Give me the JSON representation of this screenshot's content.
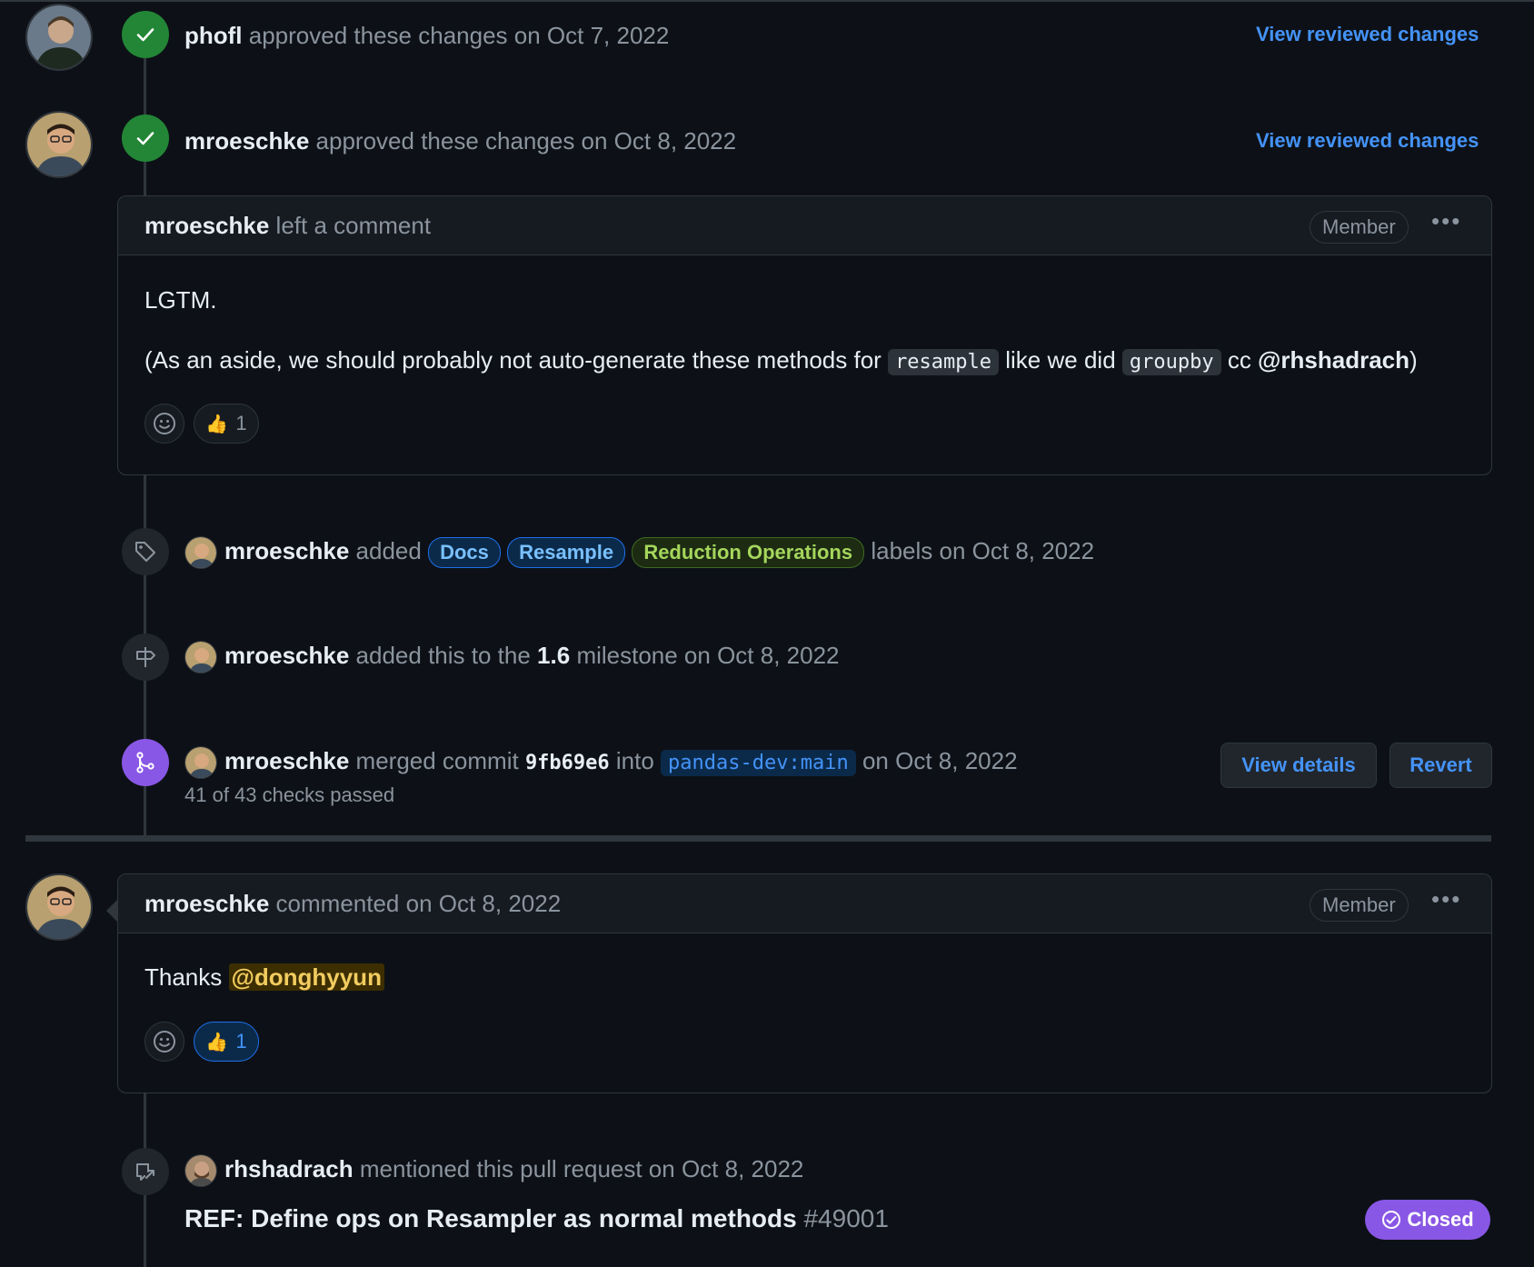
{
  "reviews": [
    {
      "user": "phofl",
      "action": "approved these changes on Oct 7, 2022",
      "link": "View reviewed changes"
    },
    {
      "user": "mroeschke",
      "action": "approved these changes on Oct 8, 2022",
      "link": "View reviewed changes"
    }
  ],
  "review_comment": {
    "user": "mroeschke",
    "action": "left a comment",
    "role": "Member",
    "line1": "LGTM.",
    "line2_part1": "(As an aside, we should probably not auto-generate these methods for ",
    "code1": "resample",
    "line2_part2": " like we did ",
    "code2": "groupby",
    "line2_part3": " cc ",
    "mention": "@rhshadrach",
    "line2_part4": ")",
    "reaction_emoji": "👍",
    "reaction_count": "1"
  },
  "labels_event": {
    "user": "mroeschke",
    "verb": "added",
    "labels": [
      {
        "name": "Docs",
        "bg": "#0b2a4a",
        "fg": "#79c0ff",
        "border": "#1f6feb"
      },
      {
        "name": "Resample",
        "bg": "#0b2a4a",
        "fg": "#79c0ff",
        "border": "#1f6feb"
      },
      {
        "name": "Reduction Operations",
        "bg": "#1c2b12",
        "fg": "#a5d65c",
        "border": "#3f6a1f"
      }
    ],
    "suffix": "labels on Oct 8, 2022"
  },
  "milestone_event": {
    "user": "mroeschke",
    "prefix": "added this to the",
    "milestone": "1.6",
    "suffix": "milestone on Oct 8, 2022"
  },
  "merge_event": {
    "user": "mroeschke",
    "prefix": "merged commit",
    "commit": "9fb69e6",
    "into": "into",
    "branch": "pandas-dev:main",
    "suffix": "on Oct 8, 2022",
    "checks": "41 of 43 checks passed",
    "view_details": "View details",
    "revert": "Revert"
  },
  "comment": {
    "user": "mroeschke",
    "action": "commented on Oct 8, 2022",
    "role": "Member",
    "text": "Thanks ",
    "mention": "@donghyyun",
    "reaction_emoji": "👍",
    "reaction_count": "1"
  },
  "mention_event": {
    "user": "rhshadrach",
    "action": "mentioned this pull request on Oct 8, 2022",
    "pr_title": "REF: Define ops on Resampler as normal methods",
    "pr_number": "#49001",
    "status": "Closed"
  },
  "colors": {
    "approved": "#238636",
    "merged": "#8957e5",
    "link": "#4493f8",
    "closed_bg": "#8957e5"
  },
  "icons": [
    "check-icon",
    "tag-icon",
    "milestone-icon",
    "merge-icon",
    "smiley-icon",
    "cross-reference-icon",
    "closed-circle-icon",
    "kebab-icon"
  ]
}
